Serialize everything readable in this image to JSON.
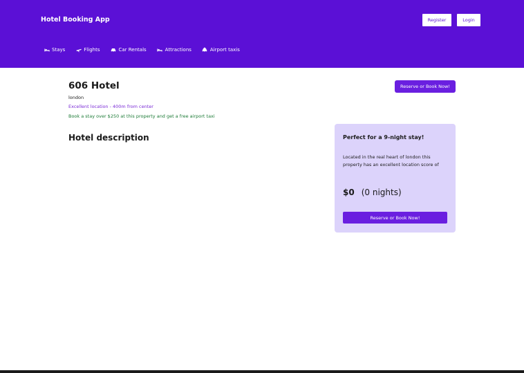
{
  "header": {
    "brand": "Hotel Booking App",
    "register_label": "Register",
    "login_label": "Login",
    "bg_color": "#5B10D6"
  },
  "nav": {
    "items": [
      {
        "label": "Stays",
        "icon": "bed-icon"
      },
      {
        "label": "Flights",
        "icon": "plane-icon"
      },
      {
        "label": "Car Rentals",
        "icon": "car-icon"
      },
      {
        "label": "Attractions",
        "icon": "bed-icon"
      },
      {
        "label": "Airport taxis",
        "icon": "taxi-icon"
      }
    ]
  },
  "hotel": {
    "name": "606 Hotel",
    "city": "london",
    "distance": "Excellent location - 400m from center",
    "offer": "Book a stay over $250 at this property and get a free airport taxi",
    "reserve_label": "Reserve or Book Now!",
    "description_title": "Hotel description"
  },
  "card": {
    "title": "Perfect for a 9-night stay!",
    "text": "Located in the real heart of london this property has an excellent location score of",
    "price": "$0",
    "nights": "(0 nights)",
    "reserve_label": "Reserve or Book Now!"
  }
}
